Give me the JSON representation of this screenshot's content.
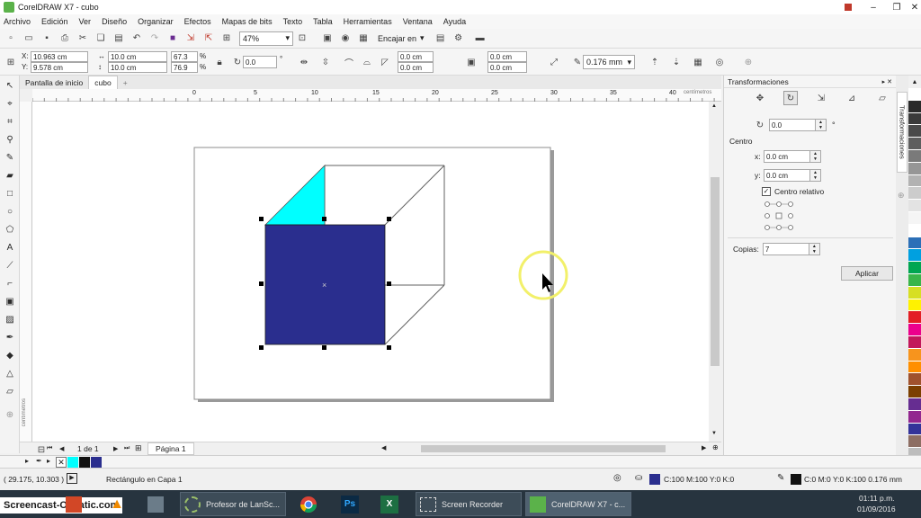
{
  "window": {
    "title": "CorelDRAW X7 - cubo"
  },
  "menu": [
    "Archivo",
    "Edición",
    "Ver",
    "Diseño",
    "Organizar",
    "Efectos",
    "Mapas de bits",
    "Texto",
    "Tabla",
    "Herramientas",
    "Ventana",
    "Ayuda"
  ],
  "standard_toolbar": {
    "zoom": "47%",
    "snap_label": "Encajar en"
  },
  "property_bar": {
    "x": "10.963 cm",
    "y": "9.578 cm",
    "w": "10.0 cm",
    "h": "10.0 cm",
    "scale_w": "67.3",
    "scale_h": "76.9",
    "pct": "%",
    "rotation": "0.0",
    "degree": "°",
    "corner_1": "0.0 cm",
    "corner_2": "0.0 cm",
    "corner_3": "0.0 cm",
    "corner_4": "0.0 cm",
    "outline_width": "0.176 mm"
  },
  "doc_tabs": {
    "home": "Pantalla de inicio",
    "active": "cubo",
    "add": "+"
  },
  "ruler": {
    "ticks": [
      "0",
      "5",
      "10",
      "15",
      "20",
      "25",
      "30",
      "35",
      "40"
    ],
    "unit": "centímetros"
  },
  "vruler_unit": "centímetros",
  "colors": {
    "cyan_face": "#00ffff",
    "front_face": "#2a2e8e",
    "highlight_ring": "#f2f06a"
  },
  "page_nav": {
    "counter": "1 de 1",
    "page_tab": "Página 1"
  },
  "docker": {
    "title": "Transformaciones",
    "vertical_tab": "Transformaciones",
    "rotation": "0.0",
    "degree": "°",
    "center_label": "Centro",
    "x_label": "x:",
    "x_value": "0.0 cm",
    "y_label": "y:",
    "y_value": "0.0 cm",
    "relative_center": "Centro relativo",
    "copies_label": "Copias:",
    "copies_value": "7",
    "apply_button": "Aplicar"
  },
  "palette": [
    "#ffffff",
    "#2a2a2a",
    "#3a3a3a",
    "#4a4a4a",
    "#5e5e5e",
    "#7a7a7a",
    "#969696",
    "#b2b2b2",
    "#cccccc",
    "#e3e3e3",
    "#f5f5f5",
    "#ffffff",
    "#2c6fb7",
    "#00a0e0",
    "#00a651",
    "#39b54a",
    "#d7df23",
    "#fff200",
    "#e31e24",
    "#ec008c",
    "#c2185b",
    "#f7941d",
    "#ff8f00",
    "#a0522d",
    "#7b3f00",
    "#662d91",
    "#92278f",
    "#333399",
    "#8d6e63",
    "#bdbdbd"
  ],
  "status": {
    "coords": "( 29.175, 10.303 )",
    "object": "Rectángulo en Capa 1",
    "fill": "C:100 M:100 Y:0 K:0",
    "outline": "C:0 M:0 Y:0 K:100  0.176 mm"
  },
  "taskbar": {
    "watermark": "Screencast-O-Matic.com",
    "task_profesor": "Profesor de LanSc...",
    "task_recorder": "Screen Recorder",
    "task_corel": "CorelDRAW X7 - c...",
    "time": "01:11 p.m.",
    "date": "01/09/2016"
  }
}
